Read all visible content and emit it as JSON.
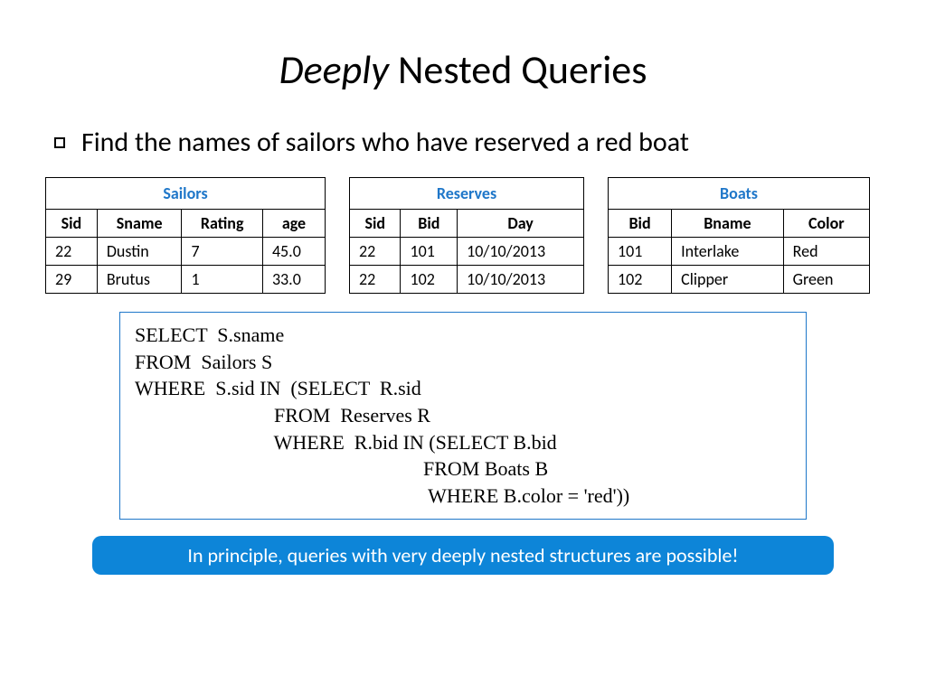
{
  "title": {
    "emph": "Deeply",
    "rest": " Nested Queries"
  },
  "bullet": "Find the names of sailors who have reserved a red boat",
  "tables": {
    "sailors": {
      "caption": "Sailors",
      "headers": [
        "Sid",
        "Sname",
        "Rating",
        "age"
      ],
      "rows": [
        [
          "22",
          "Dustin",
          "7",
          "45.0"
        ],
        [
          "29",
          "Brutus",
          "1",
          "33.0"
        ]
      ]
    },
    "reserves": {
      "caption": "Reserves",
      "headers": [
        "Sid",
        "Bid",
        "Day"
      ],
      "rows": [
        [
          "22",
          "101",
          "10/10/2013"
        ],
        [
          "22",
          "102",
          "10/10/2013"
        ]
      ]
    },
    "boats": {
      "caption": "Boats",
      "headers": [
        "Bid",
        "Bname",
        "Color"
      ],
      "rows": [
        [
          "101",
          "Interlake",
          "Red"
        ],
        [
          "102",
          "Clipper",
          "Green"
        ]
      ]
    }
  },
  "sql": "SELECT  S.sname\nFROM  Sailors S\nWHERE  S.sid IN  (SELECT  R.sid\n                            FROM  Reserves R\n                            WHERE  R.bid IN (SELECT B.bid\n                                                          FROM Boats B\n                                                           WHERE B.color = 'red'))",
  "footer": "In principle, queries with very deeply nested structures are possible!"
}
